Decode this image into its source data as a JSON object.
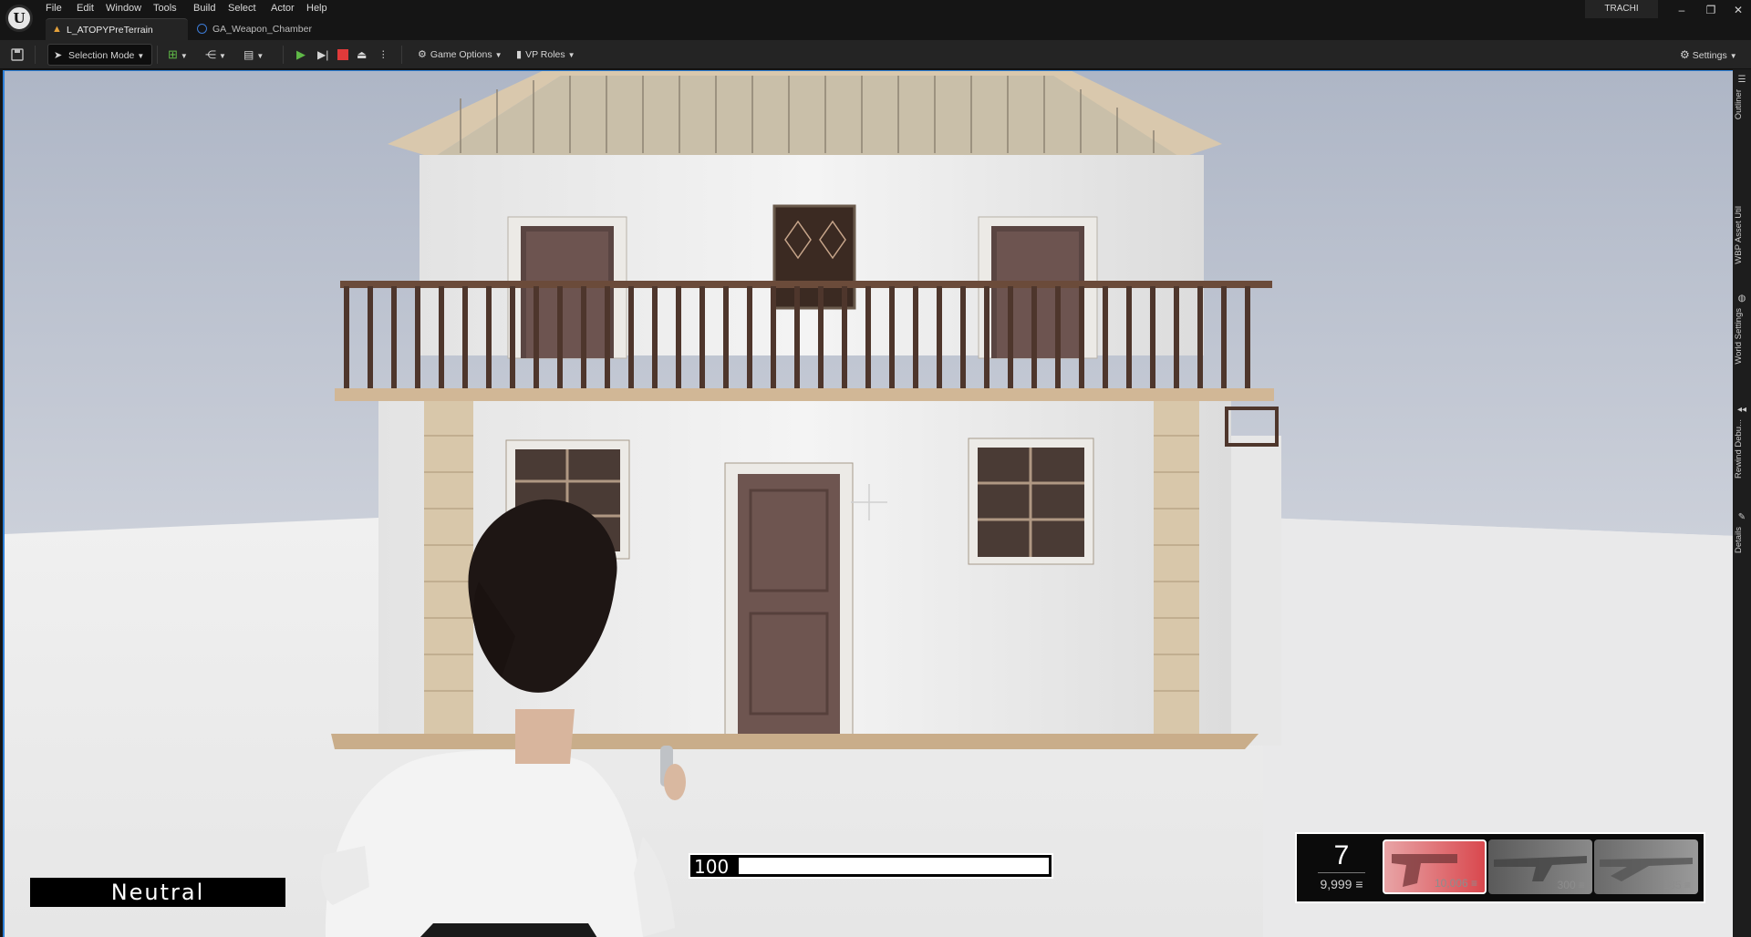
{
  "app": {
    "logo": "unreal-logo",
    "user": "TRACHI"
  },
  "menu": [
    "File",
    "Edit",
    "Window",
    "Tools",
    "Build",
    "Select",
    "Actor",
    "Help"
  ],
  "tabs": [
    {
      "label": "L_ATOPYPreTerrain",
      "icon": "level-icon",
      "active": true
    },
    {
      "label": "GA_Weapon_Chamber",
      "icon": "blueprint-icon",
      "active": false
    }
  ],
  "window_controls": {
    "minimize": "–",
    "restore": "❐",
    "close": "✕"
  },
  "toolbar": {
    "selection_mode": "Selection Mode",
    "game_options": "Game Options",
    "vp_roles": "VP Roles",
    "settings": "Settings"
  },
  "right_panel": [
    "Outliner",
    "WBP Asset Util",
    "World Settings",
    "Rewind Debu...",
    "Details"
  ],
  "hud": {
    "mood": "Neutral",
    "health": "100",
    "health_fraction": 1.0,
    "ammo_magazine": "7",
    "ammo_reserve": "9,999",
    "weapons": [
      {
        "name": "pistol",
        "count": "10,006",
        "selected": true
      },
      {
        "name": "rifle",
        "count": "300",
        "selected": false
      },
      {
        "name": "shotgun",
        "count": "185",
        "selected": false
      }
    ]
  },
  "colors": {
    "accent": "#2d7fd6",
    "play": "#5fb847",
    "stop": "#e03a3a",
    "selected_weapon": "#d9484e"
  }
}
